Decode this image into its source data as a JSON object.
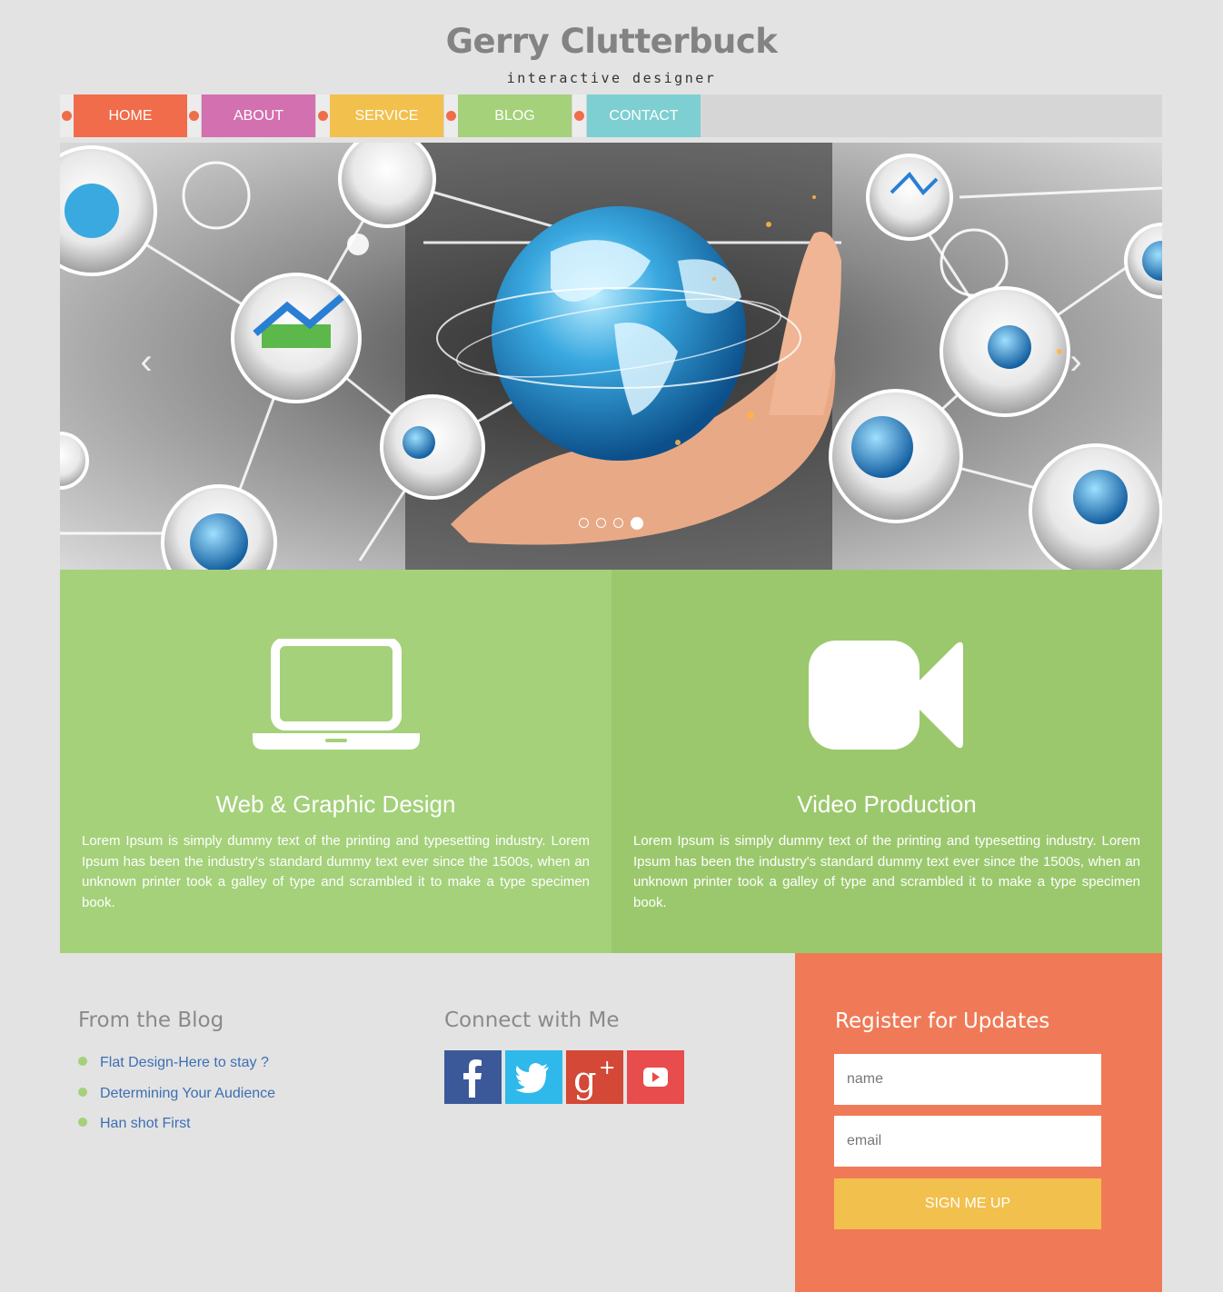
{
  "header": {
    "title": "Gerry Clutterbuck",
    "subtitle": "interactive designer"
  },
  "nav": {
    "items": [
      {
        "label": "HOME",
        "color": "#f06c4b"
      },
      {
        "label": "ABOUT",
        "color": "#d370b0"
      },
      {
        "label": "SERVICE",
        "color": "#f2c04c"
      },
      {
        "label": "BLOG",
        "color": "#a4d17a"
      },
      {
        "label": "CONTACT",
        "color": "#7ecfd2"
      }
    ]
  },
  "slider": {
    "prev_icon": "chevron-left-icon",
    "next_icon": "chevron-right-icon",
    "slide_count": 4,
    "active_slide": 4
  },
  "features": [
    {
      "icon": "laptop-icon",
      "title": "Web & Graphic Design",
      "text": "Lorem Ipsum is simply dummy text of the printing and typesetting industry. Lorem Ipsum has been the industry's standard dummy text ever since the 1500s, when an unknown printer took a galley of type and scrambled it to make a type specimen book.",
      "color": "#a4d17a"
    },
    {
      "icon": "video-camera-icon",
      "title": "Video Production",
      "text": "Lorem Ipsum is simply dummy text of the printing and typesetting industry. Lorem Ipsum has been the industry's standard dummy text ever since the 1500s, when an unknown printer took a galley of type and scrambled it to make a type specimen book.",
      "color": "#9bc86d"
    }
  ],
  "blog": {
    "heading": "From the Blog",
    "items": [
      "Flat Design-Here to stay ?",
      "Determining Your Audience",
      "Han shot First"
    ]
  },
  "connect": {
    "heading": "Connect with Me",
    "networks": [
      {
        "name": "facebook-icon",
        "color": "#3b5998"
      },
      {
        "name": "twitter-icon",
        "color": "#2fb9ea"
      },
      {
        "name": "google-plus-icon",
        "color": "#d34836"
      },
      {
        "name": "youtube-icon",
        "color": "#e84c4c"
      }
    ]
  },
  "register": {
    "heading": "Register for Updates",
    "name_placeholder": "name",
    "email_placeholder": "email",
    "button_label": "SIGN ME UP",
    "panel_color": "#f07a57",
    "button_color": "#f2c04c"
  }
}
